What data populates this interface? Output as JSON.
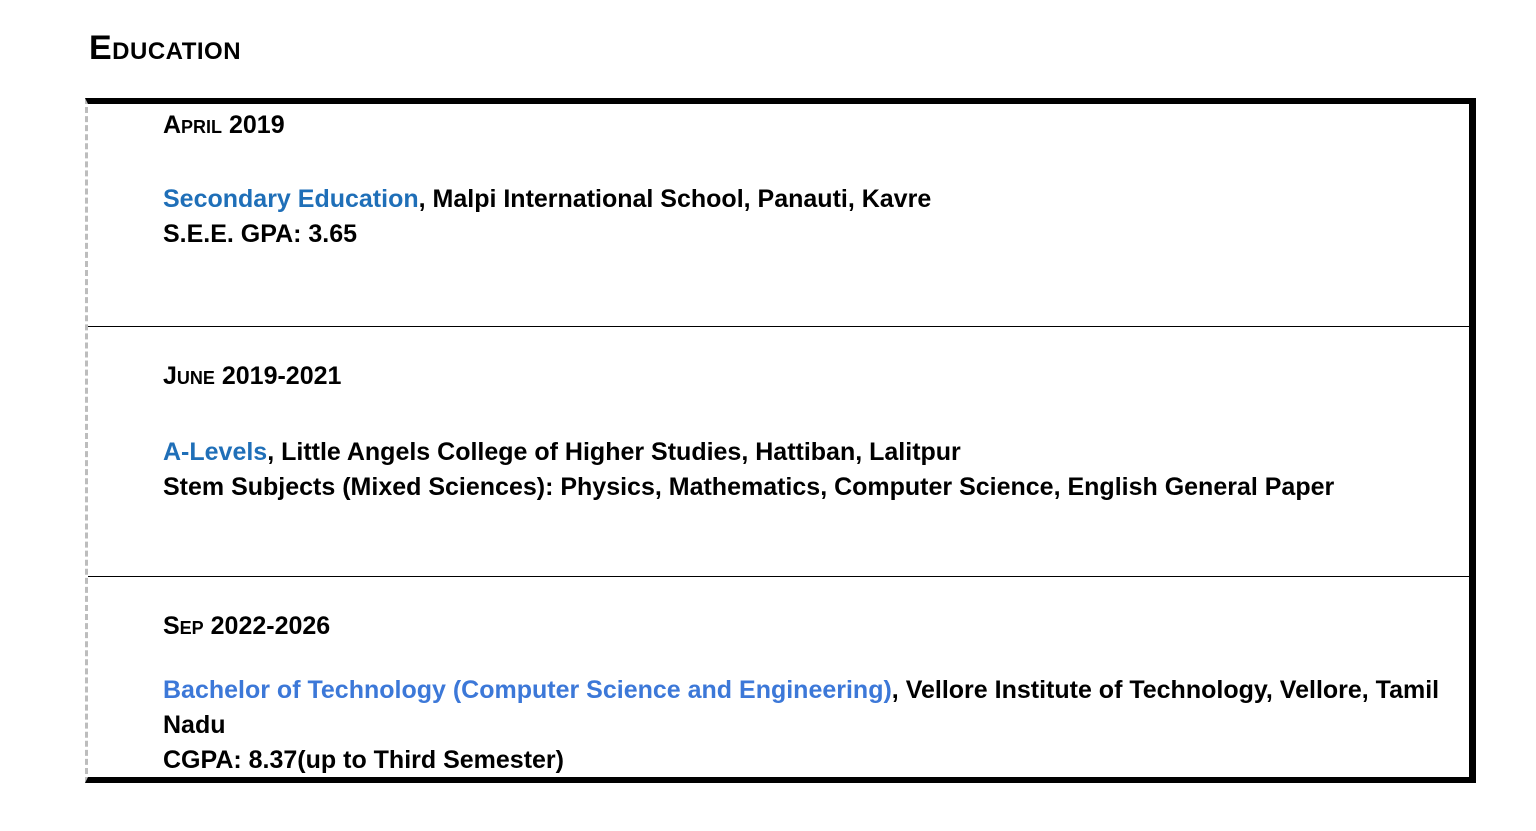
{
  "section": {
    "title": "Education"
  },
  "entries": [
    {
      "date": "April 2019",
      "degree": "Secondary Education",
      "institution": ", Malpi International School, Panauti, Kavre",
      "detail": "S.E.E. GPA: 3.65"
    },
    {
      "date": "June 2019-2021",
      "degree": "A-Levels",
      "institution": ", Little Angels College of Higher Studies, Hattiban, Lalitpur",
      "detail": "Stem Subjects (Mixed Sciences): Physics, Mathematics, Computer Science, English General Paper"
    },
    {
      "date": "Sep 2022-2026",
      "degree": "Bachelor of Technology (Computer Science and Engineering)",
      "institution": ", Vellore Institute of Technology, Vellore, Tamil Nadu",
      "detail": "CGPA: 8.37(up to Third Semester)"
    }
  ],
  "colors": {
    "degree_primary": "#1f6fb8",
    "degree_secondary": "#3c78d8",
    "text": "#000000",
    "frame_border": "#000000",
    "frame_left_dashed": "#bdbdbd"
  }
}
